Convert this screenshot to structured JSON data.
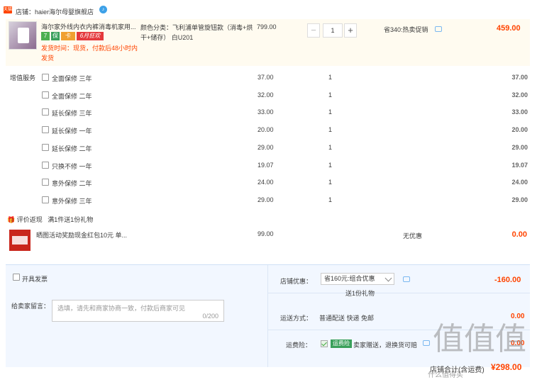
{
  "shop": {
    "tag": "天猫",
    "name": "店铺：haier海尔母婴旗舰店",
    "badge": "♪"
  },
  "product": {
    "title": "海尔家外线内衣内裤消毒机家用...",
    "icons": [
      "7",
      "保",
      "卡",
      "6月狂欢"
    ],
    "shipping": "发货时间：现货，付款后48小时内发货",
    "sku": "颜色分类：飞利浦单管旋钮款（消毒+烘干+储存） 白U201",
    "unit_price": "799.00",
    "quantity": "1",
    "promo": "省340:热卖促销",
    "subtotal": "459.00"
  },
  "services": {
    "header": "增值服务",
    "items": [
      {
        "label": "全面保修 三年",
        "price": "37.00",
        "qty": "1",
        "sum": "37.00"
      },
      {
        "label": "全面保修 二年",
        "price": "32.00",
        "qty": "1",
        "sum": "32.00"
      },
      {
        "label": "延长保修 三年",
        "price": "33.00",
        "qty": "1",
        "sum": "33.00"
      },
      {
        "label": "延长保修 一年",
        "price": "20.00",
        "qty": "1",
        "sum": "20.00"
      },
      {
        "label": "延长保修 二年",
        "price": "29.00",
        "qty": "1",
        "sum": "29.00"
      },
      {
        "label": "只换不修 一年",
        "price": "19.07",
        "qty": "1",
        "sum": "19.07"
      },
      {
        "label": "意外保修 二年",
        "price": "24.00",
        "qty": "1",
        "sum": "24.00"
      },
      {
        "label": "意外保修 三年",
        "price": "29.00",
        "qty": "1",
        "sum": "29.00"
      }
    ]
  },
  "gift": {
    "header": "评价返现",
    "header_rule": "满1件送1份礼物",
    "title": "晒图活动奖励现金红包10元 单...",
    "price": "99.00",
    "promo": "无优惠",
    "sum": "0.00"
  },
  "order": {
    "invoice_label": "开具发票",
    "message_label": "给卖家留言：",
    "message_placeholder": "选填，请先和商家协商一致，付款后商家可见",
    "message_count": "0/200",
    "discount_label": "店铺优惠：",
    "discount_selected": "省160元:组合优惠",
    "discount_sub": "送1份礼物",
    "discount_value": "-160.00",
    "shipping_label": "运送方式：",
    "shipping_method": "普通配送 快递 免邮",
    "shipping_value": "0.00",
    "insurance_label": "运费险：",
    "insurance_badge": "运费险",
    "insurance_text": "卖家赠送，退换货可赔",
    "insurance_value": "0.00",
    "total_label": "店铺合计(含运费)",
    "total_value": "¥298.00"
  },
  "watermark": {
    "main": "值值值",
    "sub": "什么值得买"
  }
}
